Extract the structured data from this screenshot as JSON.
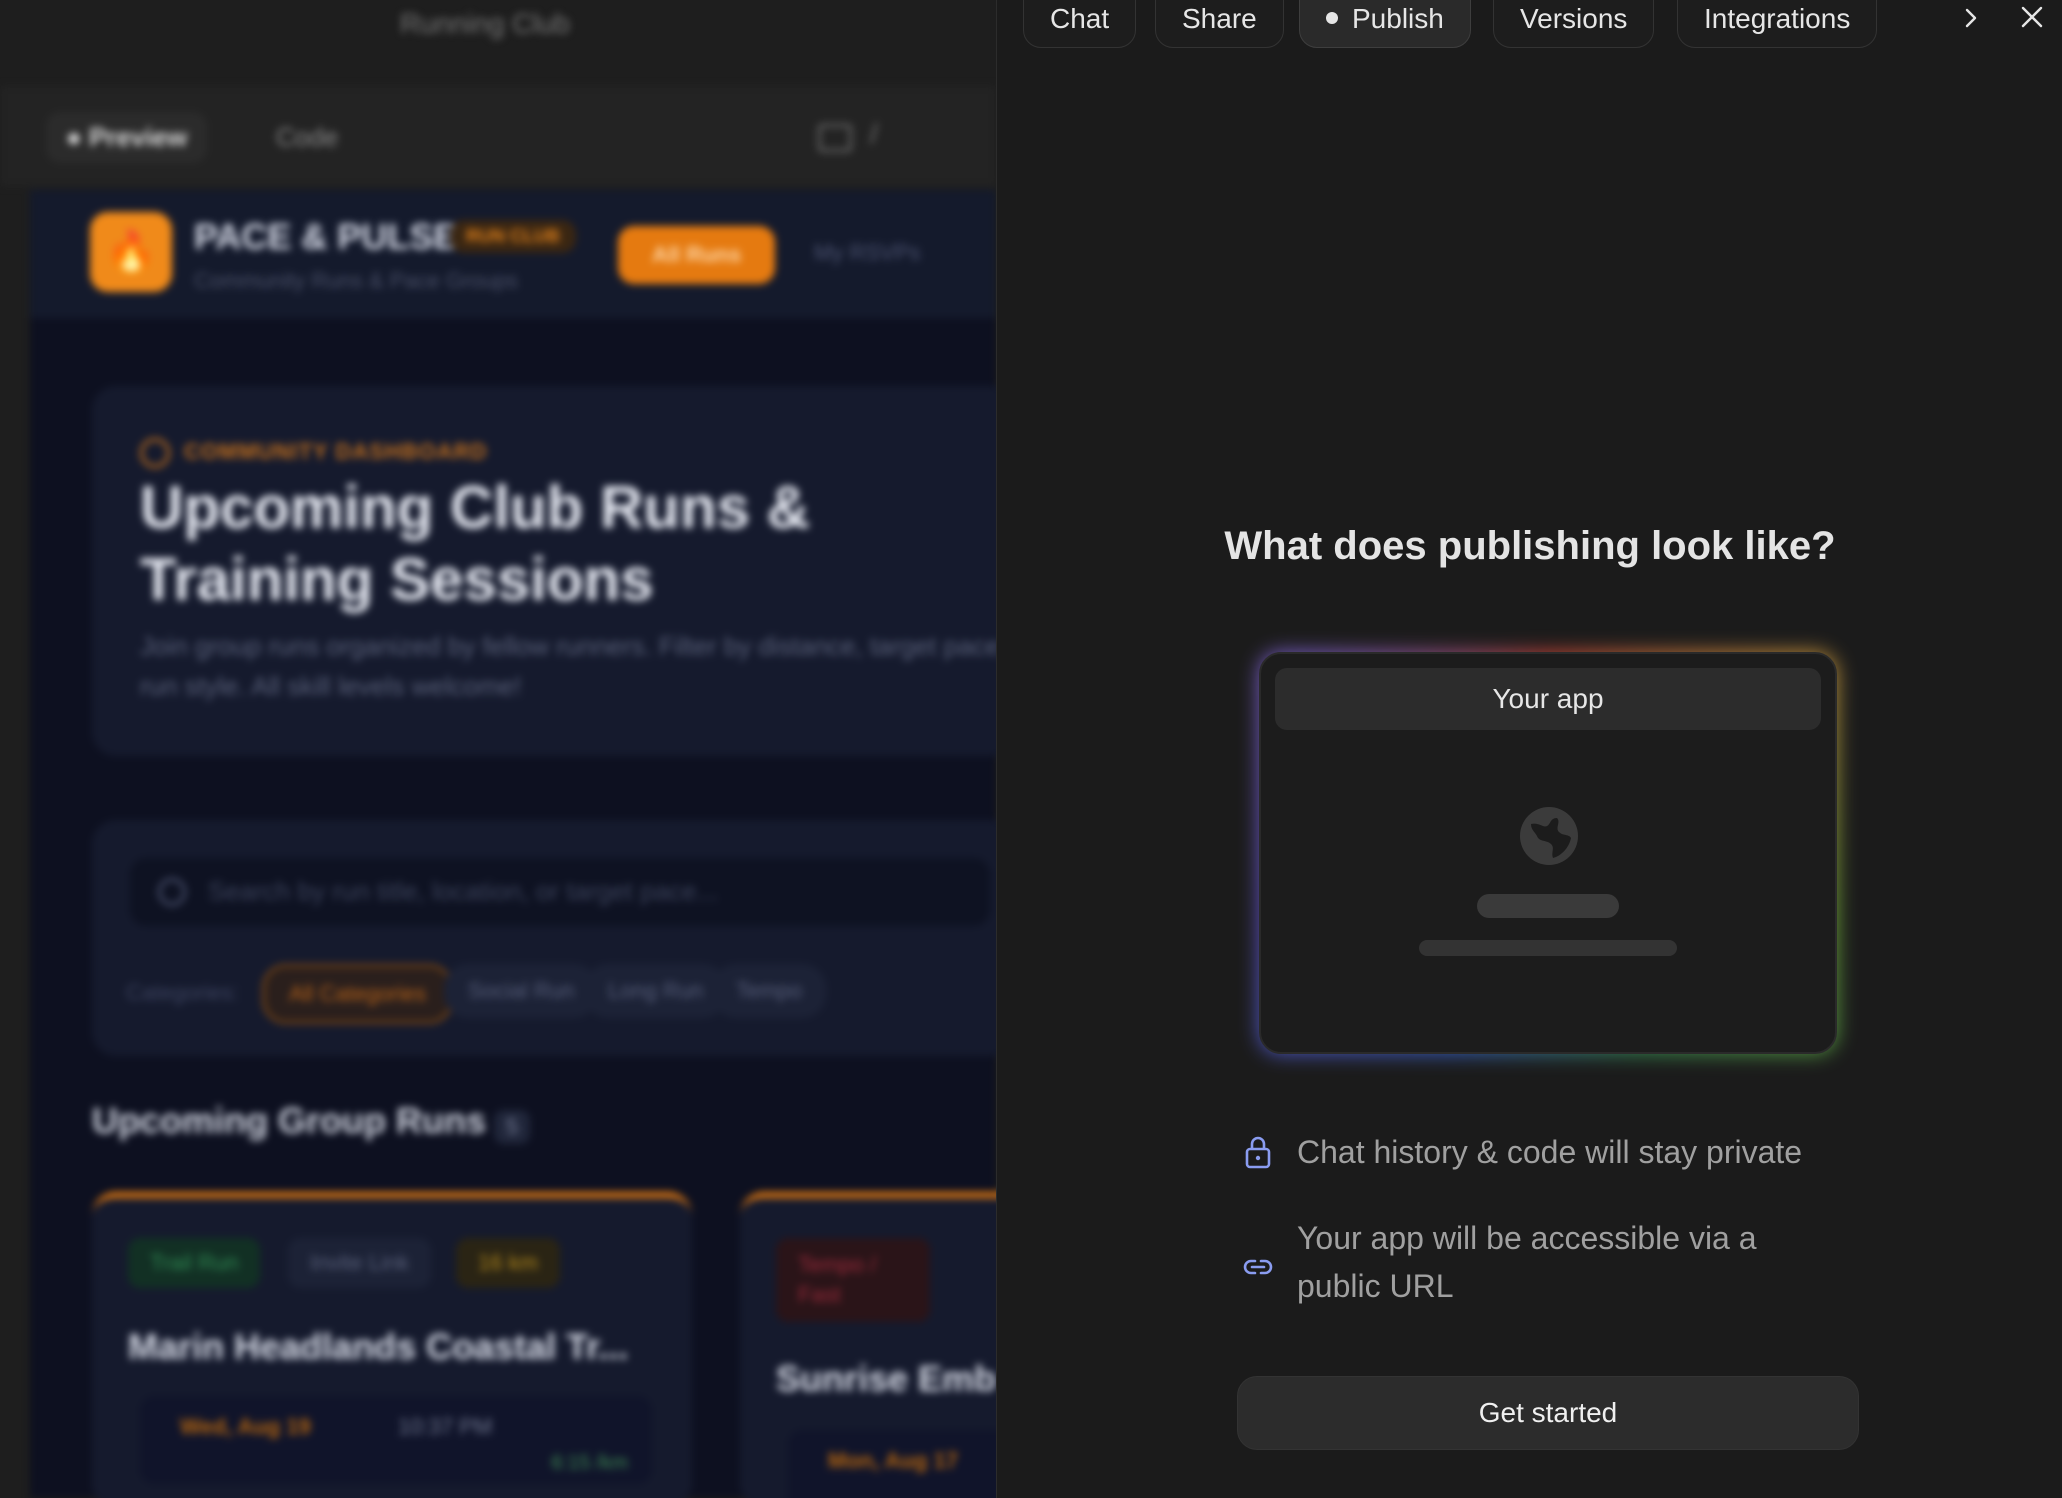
{
  "left_preview": {
    "window_title": "Running Club",
    "toolbar": {
      "preview_label": "Preview",
      "code_label": "Code",
      "path_separator": "/"
    },
    "app": {
      "logo_glyph": "🔥",
      "brand_name": "PACE & PULSE",
      "brand_badge": "RUN CLUB",
      "brand_subtitle": "Community Runs & Pace Groups",
      "nav": {
        "all_runs": "All Runs",
        "my_rsvps": "My RSVPs"
      },
      "hero": {
        "kicker": "COMMUNITY DASHBOARD",
        "title": "Upcoming Club Runs & Training Sessions",
        "description": "Join group runs organized by fellow runners. Filter by distance, target pace, or run style. All skill levels welcome!"
      },
      "search": {
        "placeholder": "Search by run title, location, or target pace..."
      },
      "categories": {
        "label": "Categories:",
        "items": [
          "All Categories",
          "Social Run",
          "Long Run",
          "Tempo"
        ]
      },
      "section": {
        "title": "Upcoming Group Runs",
        "count": "5"
      },
      "cards": [
        {
          "chips": [
            "Trail Run",
            "Invite Link",
            "16 km"
          ],
          "title": "Marin Headlands Coastal Tr...",
          "date": "Wed, Aug 19",
          "time": "10:37 PM",
          "pace": "6:15 /km"
        },
        {
          "chips": [
            "Tempo / Fast"
          ],
          "title": "Sunrise Emb",
          "date": "Mon, Aug 17"
        }
      ]
    }
  },
  "panel": {
    "tabs": [
      {
        "label": "Chat",
        "active": false
      },
      {
        "label": "Share",
        "active": false
      },
      {
        "label": "Publish",
        "active": true
      },
      {
        "label": "Versions",
        "active": false
      },
      {
        "label": "Integrations",
        "active": false
      }
    ],
    "heading": "What does publishing look like?",
    "mockup_bar_label": "Your app",
    "info": [
      {
        "icon": "lock-icon",
        "text": "Chat history & code will stay private"
      },
      {
        "icon": "link-icon",
        "text": "Your app will be accessible via a public URL"
      }
    ],
    "cta_label": "Get started"
  }
}
